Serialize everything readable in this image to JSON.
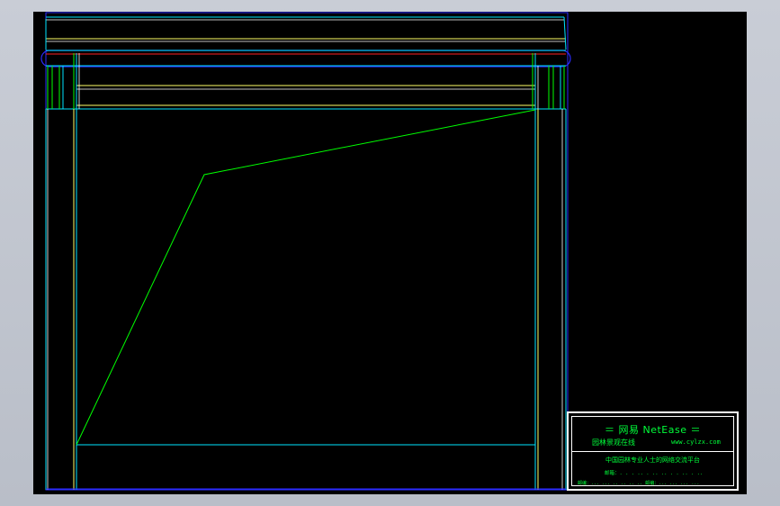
{
  "canvas": {
    "background": "#000000",
    "colors": {
      "cyan": "#00e5ff",
      "green": "#00ff00",
      "yellow": "#ffff66",
      "red": "#ff2020",
      "blue": "#2020ff",
      "white": "#ffffff"
    }
  },
  "title_block": {
    "brand": "＝ 网易 NetEase ＝",
    "subtitle": "园林景观在线",
    "site": "www.cylzx.com",
    "platform": "中国园林专业人士的网络交流平台",
    "email_line": "邮箱：.  .  . ..  . .. .. . . .. . ..",
    "mail_line": "邮编：... ... ..  ..  ..  ..   邮编：... ... ... ..."
  }
}
